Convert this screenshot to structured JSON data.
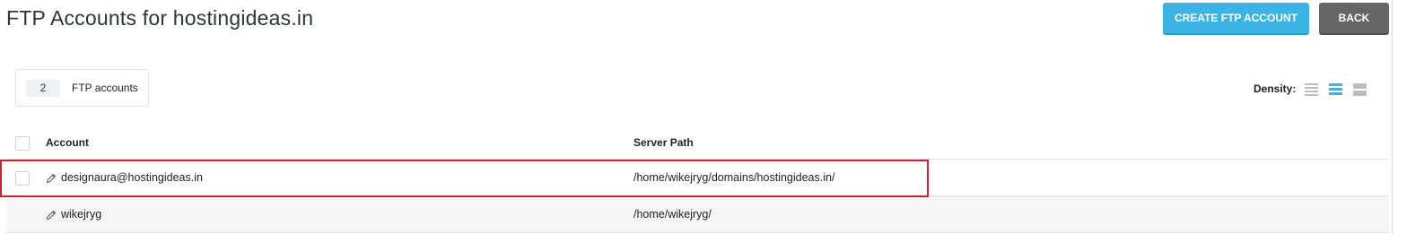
{
  "header": {
    "title": "FTP Accounts for hostingideas.in",
    "create_label": "CREATE FTP ACCOUNT",
    "back_label": "BACK"
  },
  "summary": {
    "count": "2",
    "label": "FTP accounts"
  },
  "density": {
    "label": "Density:",
    "options": [
      "compact-icon",
      "normal-icon",
      "comfortable-icon"
    ],
    "selected": "normal-icon"
  },
  "table": {
    "columns": [
      "Account",
      "Server Path"
    ],
    "rows": [
      {
        "account": "designaura@hostingideas.in",
        "path": "/home/wikejryg/domains/hostingideas.in/",
        "has_checkbox": true
      },
      {
        "account": "wikejryg",
        "path": "/home/wikejryg/",
        "has_checkbox": false
      }
    ]
  },
  "colors": {
    "primary": "#3bb4e5",
    "secondary": "#666666",
    "highlight": "#d0212f",
    "alt_row": "#f5f5f5"
  }
}
